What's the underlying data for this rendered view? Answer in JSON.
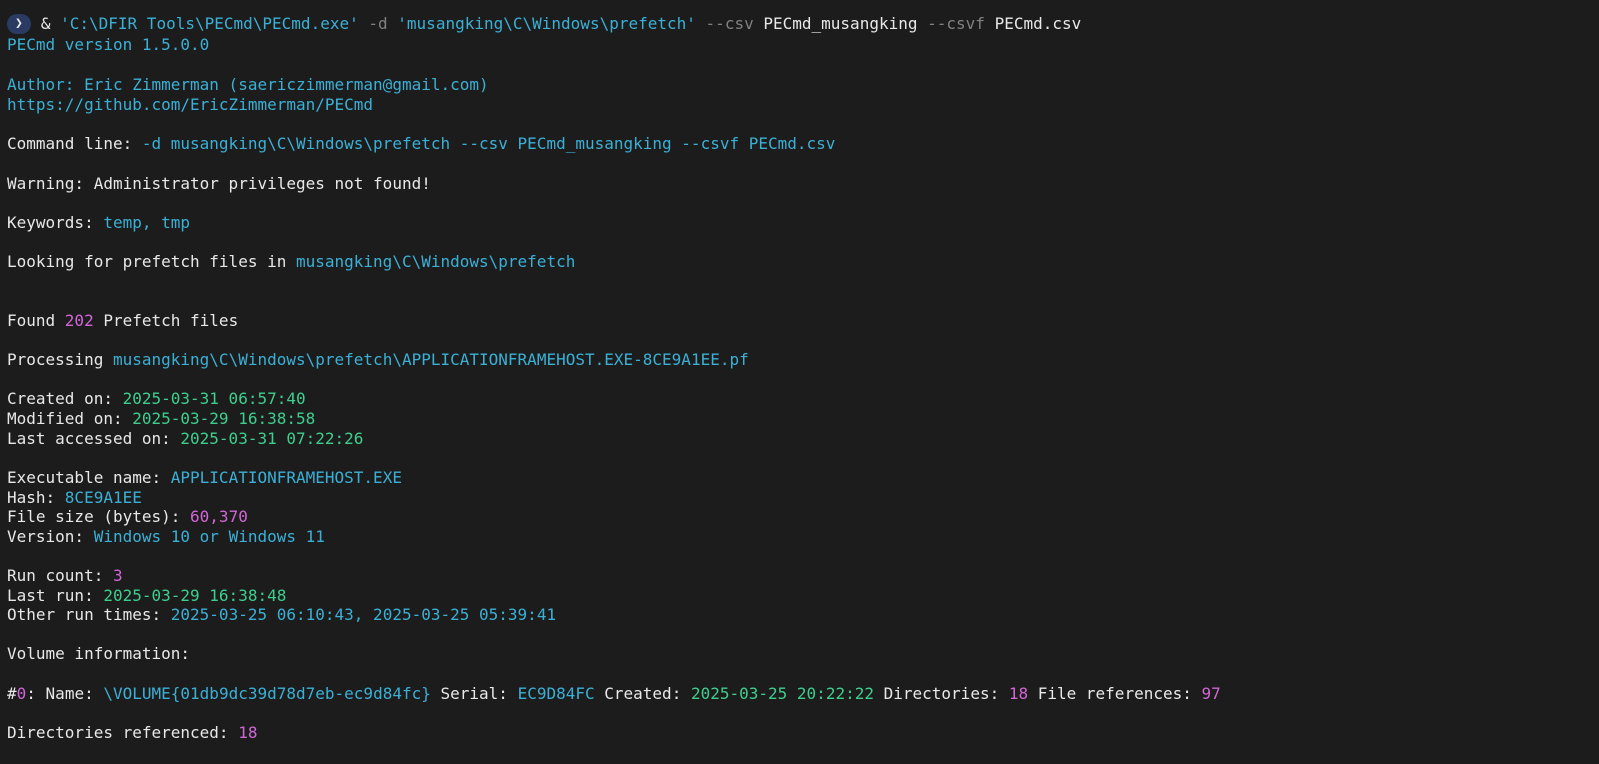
{
  "prompt": {
    "symbol": "❯",
    "amp": "&",
    "exe_path": "'C:\\DFIR Tools\\PECmd\\PECmd.exe'",
    "flag_d": "-d",
    "dir_arg": "'musangking\\C\\Windows\\prefetch'",
    "flag_csv": "--csv",
    "csv_arg": "PECmd_musangking",
    "flag_csvf": "--csvf",
    "csvf_arg": "PECmd.csv"
  },
  "header": {
    "version": "PECmd version 1.5.0.0",
    "author": "Author: Eric Zimmerman (saericzimmerman@gmail.com)",
    "url": "https://github.com/EricZimmerman/PECmd"
  },
  "cmdline": {
    "label": "Command line: ",
    "value": "-d musangking\\C\\Windows\\prefetch --csv PECmd_musangking --csvf PECmd.csv"
  },
  "warning": "Warning: Administrator privileges not found!",
  "keywords": {
    "label": "Keywords: ",
    "value": "temp, tmp"
  },
  "looking": {
    "label": "Looking for prefetch files in ",
    "value": "musangking\\C\\Windows\\prefetch"
  },
  "found": {
    "prefix": "Found ",
    "count": "202",
    "suffix": " Prefetch files"
  },
  "processing": {
    "label": "Processing ",
    "value": "musangking\\C\\Windows\\prefetch\\APPLICATIONFRAMEHOST.EXE-8CE9A1EE.pf"
  },
  "file_times": {
    "created_label": "Created on: ",
    "created_value": "2025-03-31 06:57:40",
    "modified_label": "Modified on: ",
    "modified_value": "2025-03-29 16:38:58",
    "accessed_label": "Last accessed on: ",
    "accessed_value": "2025-03-31 07:22:26"
  },
  "exe_info": {
    "name_label": "Executable name: ",
    "name_value": "APPLICATIONFRAMEHOST.EXE",
    "hash_label": "Hash: ",
    "hash_value": "8CE9A1EE",
    "size_label": "File size (bytes): ",
    "size_value": "60,370",
    "version_label": "Version: ",
    "version_value": "Windows 10 or Windows 11"
  },
  "run_info": {
    "count_label": "Run count: ",
    "count_value": "3",
    "last_label": "Last run: ",
    "last_value": "2025-03-29 16:38:48",
    "other_label": "Other run times: ",
    "other_value": "2025-03-25 06:10:43, 2025-03-25 05:39:41"
  },
  "volume": {
    "header": "Volume information:",
    "hash": "#",
    "index": "0",
    "name_label": ": Name: ",
    "name_value": "\\VOLUME{01db9dc39d78d7eb-ec9d84fc}",
    "serial_label": " Serial: ",
    "serial_value": "EC9D84FC",
    "created_label": " Created: ",
    "created_value": "2025-03-25 20:22:22",
    "dirs_label": " Directories: ",
    "dirs_value": "18",
    "refs_label": " File references: ",
    "refs_value": "97"
  },
  "dirs_referenced": {
    "label": "Directories referenced: ",
    "value": "18"
  }
}
